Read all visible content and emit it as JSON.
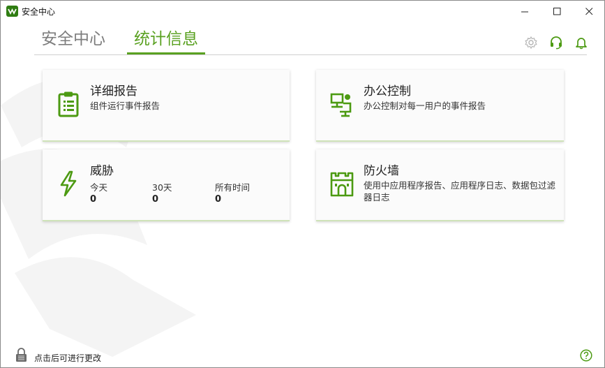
{
  "window": {
    "title": "安全中心",
    "minimize": "—",
    "maximize": "☐",
    "close": "✕"
  },
  "tabs": [
    {
      "label": "安全中心",
      "active": false
    },
    {
      "label": "统计信息",
      "active": true
    }
  ],
  "header_icons": [
    "gear-icon",
    "headset-icon",
    "bell-icon"
  ],
  "cards": {
    "reports": {
      "title": "详细报告",
      "desc": "组件运行事件报告",
      "icon": "clipboard-icon"
    },
    "office": {
      "title": "办公控制",
      "desc": "办公控制对每一用户的事件报告",
      "icon": "workstation-icon"
    },
    "threats": {
      "title": "威胁",
      "icon": "lightning-icon",
      "stats": [
        {
          "label": "今天",
          "value": "0"
        },
        {
          "label": "30天",
          "value": "0"
        },
        {
          "label": "所有时间",
          "value": "0"
        }
      ]
    },
    "firewall": {
      "title": "防火墙",
      "desc": "使用中应用程序报告、应用程序日志、数据包过滤器日志",
      "icon": "castle-icon"
    }
  },
  "footer": {
    "lock_text": "点击后可进行更改",
    "help_icon": "help-icon"
  },
  "colors": {
    "accent": "#5aa121",
    "tab_inactive": "#7d7d7d"
  }
}
